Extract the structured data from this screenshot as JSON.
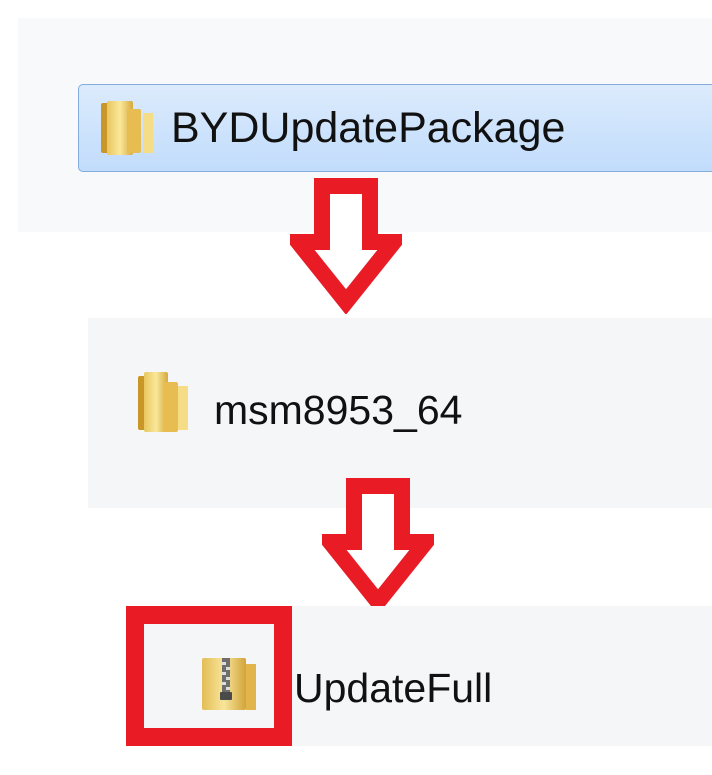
{
  "items": {
    "folder1": {
      "label": "BYDUpdatePackage",
      "icon": "folder-icon"
    },
    "folder2": {
      "label": "msm8953_64",
      "icon": "folder-icon"
    },
    "file": {
      "label": "UpdateFull",
      "icon": "zip-folder-icon"
    }
  },
  "colors": {
    "arrow": "#e91c26",
    "highlight": "#e91c26",
    "selection": "#cce4fc"
  }
}
